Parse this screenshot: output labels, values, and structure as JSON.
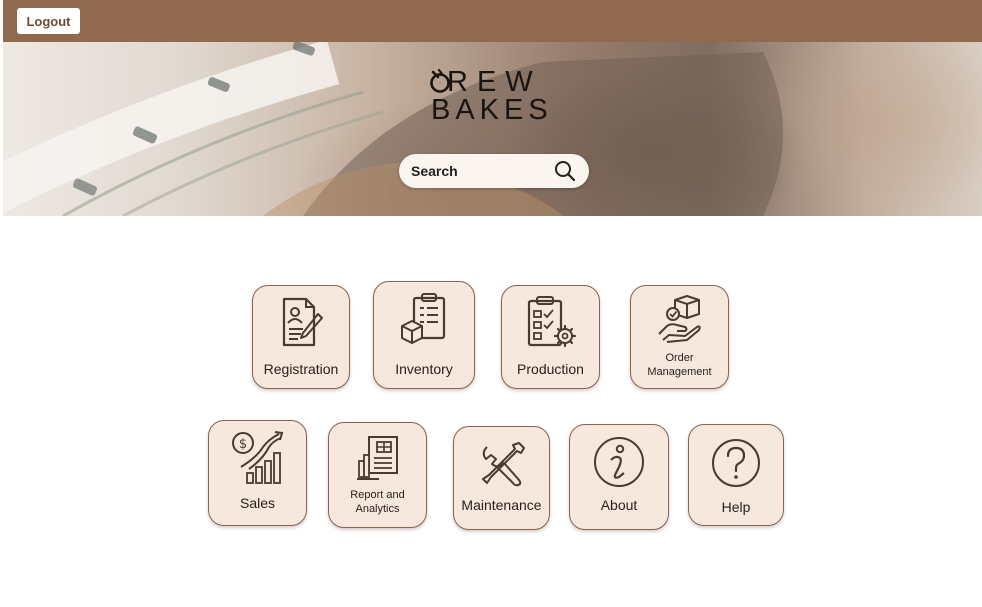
{
  "topbar": {
    "logout_label": "Logout"
  },
  "header": {
    "logo_line1": "REW",
    "logo_line2": "BAKES",
    "search": {
      "placeholder": "Search"
    }
  },
  "tiles": {
    "registration": {
      "label": "Registration",
      "icon": "registration-form-icon"
    },
    "inventory": {
      "label": "Inventory",
      "icon": "inventory-clipboard-icon"
    },
    "production": {
      "label": "Production",
      "icon": "production-checklist-gear-icon"
    },
    "order_management": {
      "label": "Order Management",
      "icon": "order-hand-box-icon"
    },
    "sales": {
      "label": "Sales",
      "icon": "sales-growth-chart-icon"
    },
    "report_analytics": {
      "label": "Report and Analytics",
      "icon": "report-document-chart-icon"
    },
    "maintenance": {
      "label": "Maintenance",
      "icon": "wrench-screwdriver-icon"
    },
    "about": {
      "label": "About",
      "icon": "info-icon"
    },
    "help": {
      "label": "Help",
      "icon": "question-icon"
    }
  },
  "colors": {
    "topbar": "#8f6a4e",
    "tile_fill": "#f6e8dd",
    "tile_border": "#8a6250",
    "icon_stroke": "#4a3a32"
  }
}
